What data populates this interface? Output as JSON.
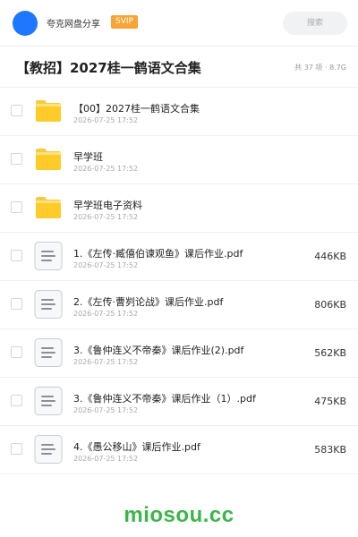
{
  "header": {
    "share_name": "夸克网盘分享",
    "badge": "SVIP",
    "search_placeholder": "搜索",
    "avatar_color": "#1e78ff"
  },
  "folder": {
    "title": "【教招】2027桂一鹤语文合集",
    "meta": "共 37 项 · 8.7G"
  },
  "items": [
    {
      "type": "folder",
      "name": "【00】2027桂一鹤语文合集",
      "date": "2026-07-25 17:52",
      "size": ""
    },
    {
      "type": "folder",
      "name": "早学班",
      "date": "2026-07-25 17:52",
      "size": ""
    },
    {
      "type": "folder",
      "name": "早学班电子资料",
      "date": "2026-07-25 17:52",
      "size": ""
    },
    {
      "type": "file",
      "name": "1.《左传·臧僖伯谏观鱼》课后作业.pdf",
      "date": "2026-07-25 17:52",
      "size": "446KB"
    },
    {
      "type": "file",
      "name": "2.《左传·曹刿论战》课后作业.pdf",
      "date": "2026-07-25 17:52",
      "size": "806KB"
    },
    {
      "type": "file",
      "name": "3.《鲁仲连义不帝秦》课后作业(2).pdf",
      "date": "2026-07-25 17:52",
      "size": "562KB"
    },
    {
      "type": "file",
      "name": "3.《鲁仲连义不帝秦》课后作业（1）.pdf",
      "date": "2026-07-25 17:52",
      "size": "475KB"
    },
    {
      "type": "file",
      "name": "4.《愚公移山》课后作业.pdf",
      "date": "2026-07-25 17:52",
      "size": "583KB"
    }
  ],
  "footer": {
    "watermark": "miosou.cc",
    "watermark_color": "#3cb54a"
  }
}
